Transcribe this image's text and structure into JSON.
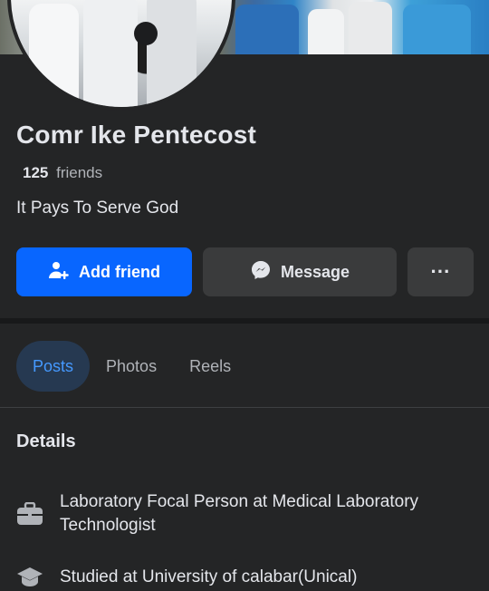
{
  "profile": {
    "name": "Comr Ike Pentecost",
    "friends_count": "125",
    "friends_label": "friends",
    "bio": "It Pays To Serve God"
  },
  "actions": {
    "add_friend": "Add friend",
    "message": "Message",
    "more": "···"
  },
  "tabs": [
    {
      "label": "Posts",
      "active": true
    },
    {
      "label": "Photos",
      "active": false
    },
    {
      "label": "Reels",
      "active": false
    }
  ],
  "details": {
    "title": "Details",
    "items": [
      {
        "icon": "briefcase-icon",
        "text": "Laboratory Focal Person at Medical Laboratory Technologist"
      },
      {
        "icon": "graduation-cap-icon",
        "text": "Studied at University of calabar(Unical)"
      }
    ]
  },
  "colors": {
    "background": "#242526",
    "primary": "#0866ff",
    "secondary_button": "#3a3b3c",
    "active_tab_bg": "#263951",
    "active_tab_text": "#4599ff"
  }
}
